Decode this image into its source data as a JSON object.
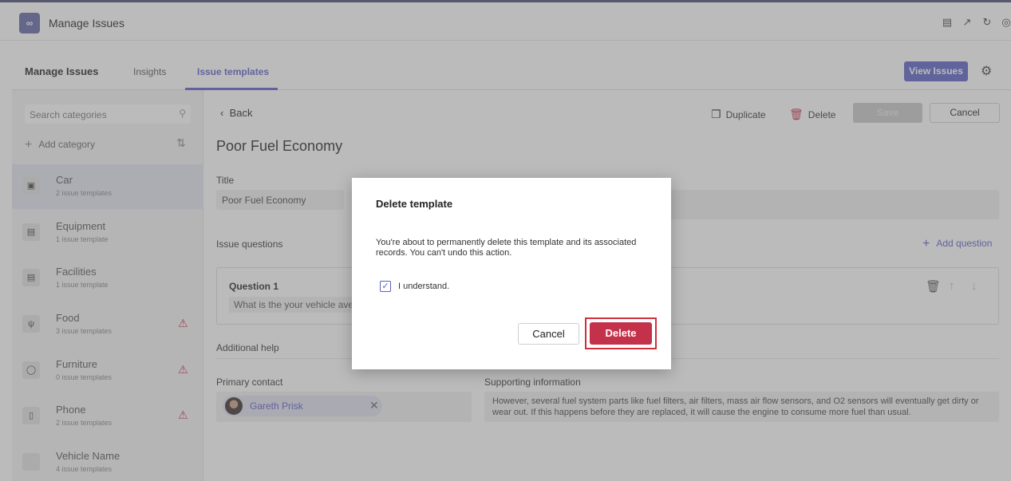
{
  "app": {
    "title": "Manage Issues",
    "logo": "∞"
  },
  "header_icons": [
    "chat-icon",
    "collapse-icon",
    "refresh-icon",
    "globe-icon"
  ],
  "tabs": {
    "main": "Manage Issues",
    "items": [
      {
        "label": "Insights",
        "active": false
      },
      {
        "label": "Issue templates",
        "active": true
      }
    ],
    "view_issues": "View Issues"
  },
  "sidebar": {
    "search_placeholder": "Search categories",
    "add_category": "Add category",
    "categories": [
      {
        "name": "Car",
        "count": "2 issue templates",
        "icon": "car-icon",
        "warning": false,
        "selected": true
      },
      {
        "name": "Equipment",
        "count": "1 issue template",
        "icon": "briefcase-icon",
        "warning": false,
        "selected": false
      },
      {
        "name": "Facilities",
        "count": "1 issue template",
        "icon": "briefcase-icon",
        "warning": false,
        "selected": false
      },
      {
        "name": "Food",
        "count": "3 issue templates",
        "icon": "food-icon",
        "warning": true,
        "selected": false
      },
      {
        "name": "Furniture",
        "count": "0 issue templates",
        "icon": "lightbulb-icon",
        "warning": true,
        "selected": false
      },
      {
        "name": "Phone",
        "count": "2 issue templates",
        "icon": "phone-icon",
        "warning": true,
        "selected": false
      },
      {
        "name": "Vehicle Name",
        "count": "4 issue templates",
        "icon": "blank-icon",
        "warning": false,
        "selected": false
      }
    ]
  },
  "toolbar": {
    "back": "Back",
    "duplicate": "Duplicate",
    "delete": "Delete",
    "save": "Save",
    "cancel": "Cancel"
  },
  "template": {
    "name": "Poor Fuel Economy",
    "title_label": "Title",
    "title_value": "Poor Fuel Economy",
    "issue_questions_label": "Issue questions",
    "add_question": "Add question",
    "question1_label": "Question 1",
    "question1_text": "What is the your vehicle average fuel economy?",
    "additional_help_label": "Additional help",
    "primary_contact_label": "Primary contact",
    "primary_contact_name": "Gareth Prisk",
    "supporting_info_label": "Supporting information",
    "supporting_info_text": "However, several fuel system parts like fuel filters, air filters, mass air flow sensors, and O2 sensors will eventually get dirty or wear out. If this happens before they are replaced, it will cause the engine to consume more fuel than usual."
  },
  "dialog": {
    "title": "Delete template",
    "message": "You're about to permanently delete this template and its associated records. You can't undo this action.",
    "checkbox_label": "I understand.",
    "checked": true,
    "cancel": "Cancel",
    "delete": "Delete"
  },
  "colors": {
    "accent": "#5b5fc7",
    "danger": "#c4314b",
    "highlight": "#d32f3a"
  }
}
